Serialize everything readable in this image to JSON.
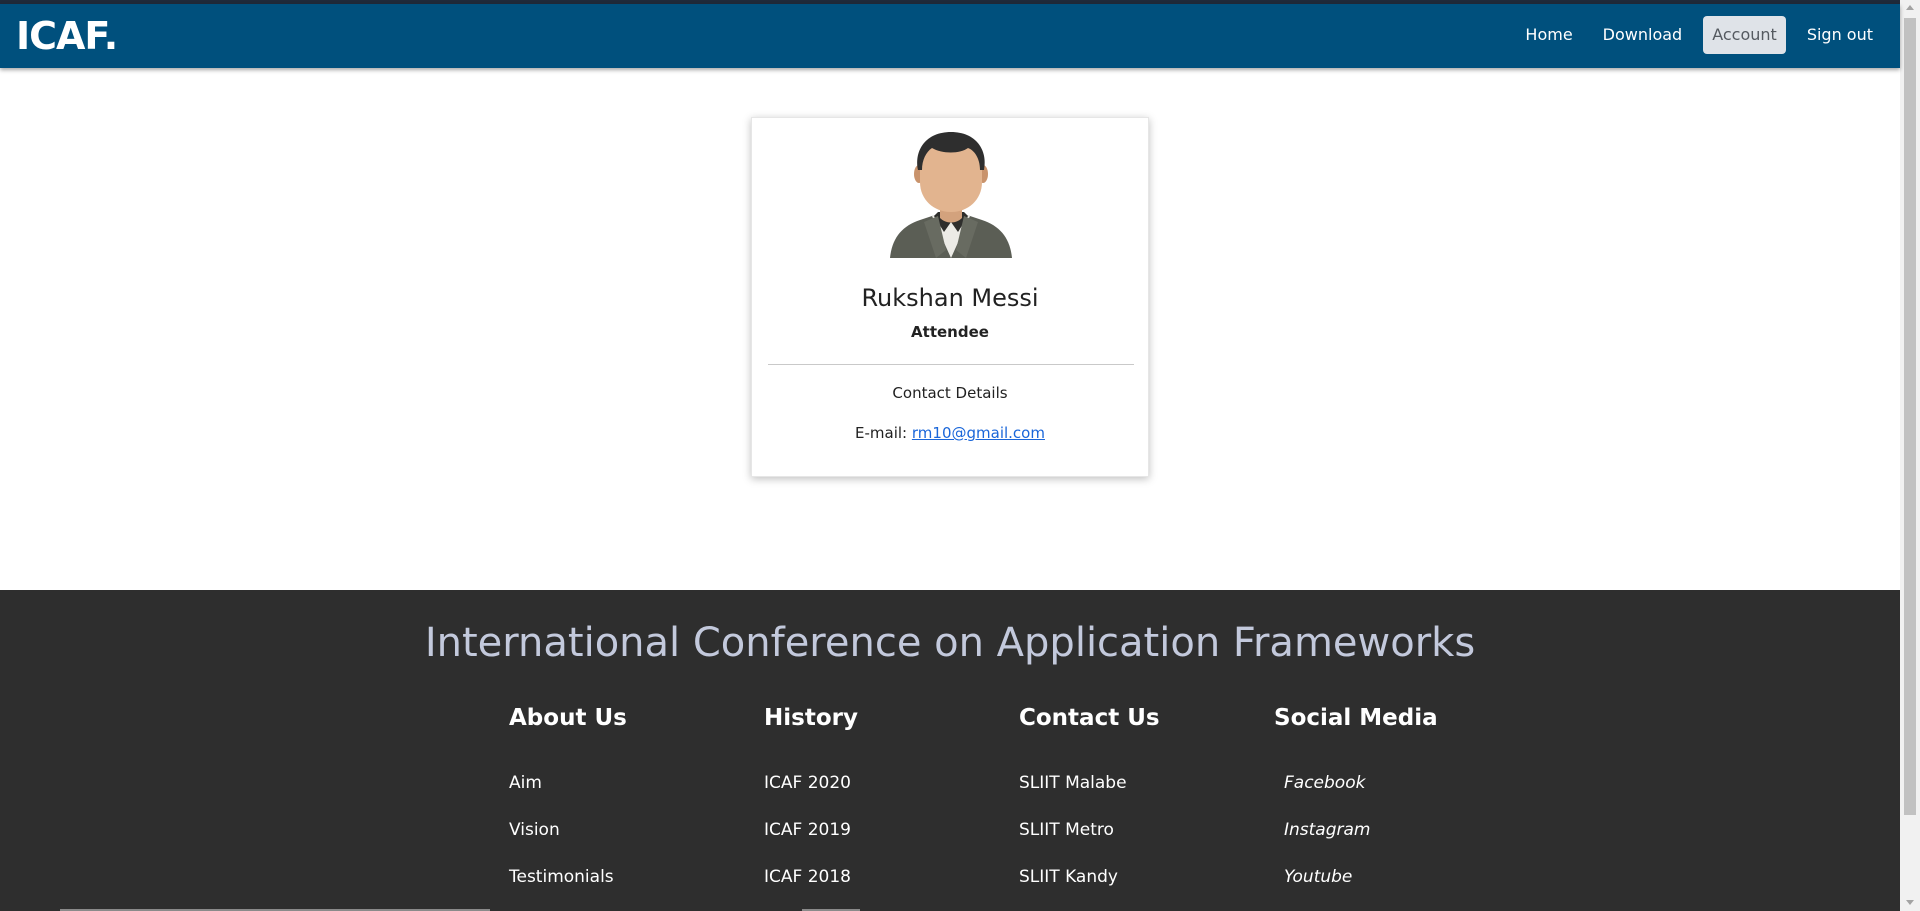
{
  "navbar": {
    "brand": "ICAF.",
    "links": [
      {
        "label": "Home",
        "active": false
      },
      {
        "label": "Download",
        "active": false
      },
      {
        "label": "Account",
        "active": true
      },
      {
        "label": "Sign out",
        "active": false
      }
    ],
    "background": "#00507d"
  },
  "profile": {
    "avatar_icon": "person-avatar-icon",
    "name": "Rukshan Messi",
    "role": "Attendee",
    "contact_heading": "Contact Details",
    "email_label": "E-mail:",
    "email": "rm10@gmail.com"
  },
  "footer": {
    "title": "International Conference on Application Frameworks",
    "columns": [
      {
        "heading": "About Us",
        "items": [
          "Aim",
          "Vision",
          "Testimonials"
        ]
      },
      {
        "heading": "History",
        "items": [
          "ICAF 2020",
          "ICAF 2019",
          "ICAF 2018"
        ]
      },
      {
        "heading": "Contact Us",
        "items": [
          "SLIIT Malabe",
          "SLIIT Metro",
          "SLIIT Kandy"
        ]
      },
      {
        "heading": "Social Media",
        "items": [
          "Facebook",
          "Instagram",
          "Youtube"
        ]
      }
    ],
    "background": "#2e2e2e"
  }
}
